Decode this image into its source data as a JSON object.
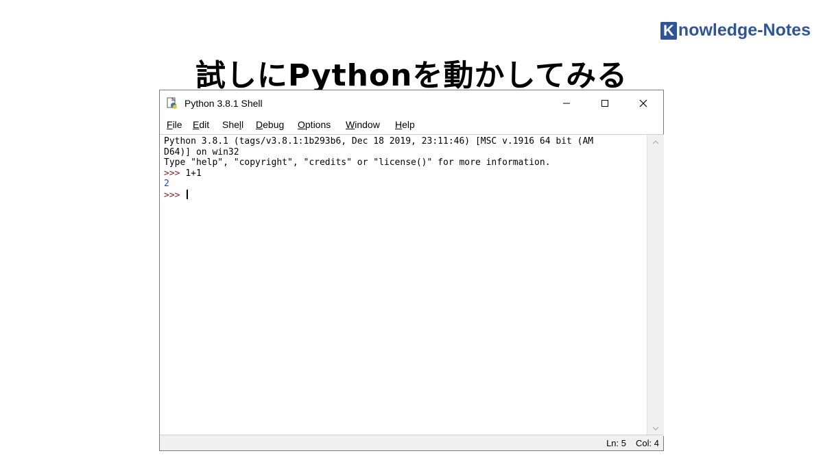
{
  "brand": {
    "initial": "K",
    "rest": "nowledge-Notes"
  },
  "slide_title": "試しにPythonを動かしてみる",
  "window": {
    "title": "Python 3.8.1 Shell",
    "buttons": {
      "minimize": "–",
      "maximize": "☐",
      "close": "✕"
    }
  },
  "menu": [
    {
      "key": "F",
      "rest": "ile"
    },
    {
      "key": "E",
      "rest": "dit"
    },
    {
      "pre": "She",
      "key": "l",
      "rest": "l"
    },
    {
      "key": "D",
      "rest": "ebug"
    },
    {
      "key": "O",
      "rest": "ptions"
    },
    {
      "key": "W",
      "rest": "indow"
    },
    {
      "key": "H",
      "rest": "elp"
    }
  ],
  "console": {
    "banner_line1": "Python 3.8.1 (tags/v3.8.1:1b293b6, Dec 18 2019, 23:11:46) [MSC v.1916 64 bit (AM",
    "banner_line2": "D64)] on win32",
    "banner_line3": "Type \"help\", \"copyright\", \"credits\" or \"license()\" for more information.",
    "prompt": ">>> ",
    "input1": "1+1",
    "output1": "2"
  },
  "status": {
    "ln": "Ln: 5",
    "col": "Col: 4"
  },
  "colors": {
    "brand": "#2f5597",
    "prompt": "#8b1a1a",
    "output": "#1f3fd6"
  },
  "icons": {
    "app": "python-idle-icon",
    "scroll_up": "chevron-up-icon",
    "scroll_down": "chevron-down-icon"
  }
}
